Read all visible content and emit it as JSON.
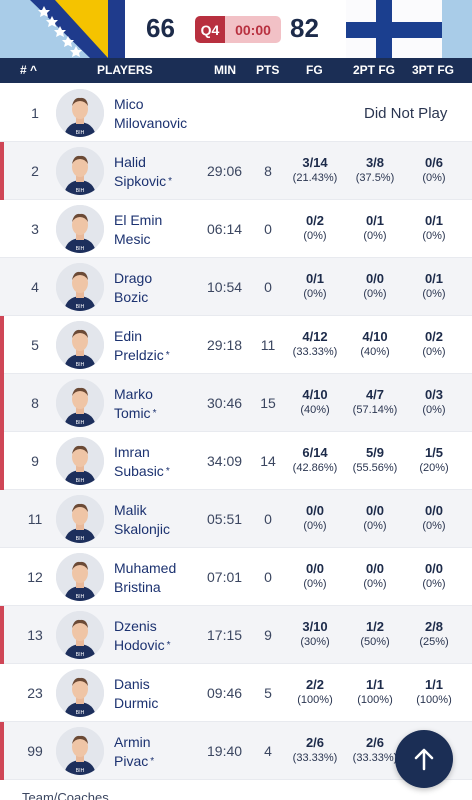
{
  "scoreboard": {
    "home_score": "66",
    "away_score": "82",
    "quarter": "Q4",
    "clock": "00:00",
    "home_flag": "bosnia-flag",
    "away_flag": "finland-flag"
  },
  "table_header": {
    "num": "#",
    "players": "PLAYERS",
    "min": "MIN",
    "pts": "PTS",
    "fg": "FG",
    "pt2": "2PT FG",
    "pt3": "3PT FG"
  },
  "players": [
    {
      "num": "1",
      "first": "Mico",
      "last": "Milovanovic",
      "starter": false,
      "dnp": "Did Not Play"
    },
    {
      "num": "2",
      "first": "Halid",
      "last": "Sipkovic",
      "starter": true,
      "min": "29:06",
      "pts": "8",
      "fg": "3/14",
      "fg_pct": "(21.43%)",
      "pt2": "3/8",
      "pt2_pct": "(37.5%)",
      "pt3": "0/6",
      "pt3_pct": "(0%)"
    },
    {
      "num": "3",
      "first": "El Emin",
      "last": "Mesic",
      "starter": false,
      "min": "06:14",
      "pts": "0",
      "fg": "0/2",
      "fg_pct": "(0%)",
      "pt2": "0/1",
      "pt2_pct": "(0%)",
      "pt3": "0/1",
      "pt3_pct": "(0%)"
    },
    {
      "num": "4",
      "first": "Drago",
      "last": "Bozic",
      "starter": false,
      "min": "10:54",
      "pts": "0",
      "fg": "0/1",
      "fg_pct": "(0%)",
      "pt2": "0/0",
      "pt2_pct": "(0%)",
      "pt3": "0/1",
      "pt3_pct": "(0%)"
    },
    {
      "num": "5",
      "first": "Edin",
      "last": "Preldzic",
      "starter": true,
      "min": "29:18",
      "pts": "11",
      "fg": "4/12",
      "fg_pct": "(33.33%)",
      "pt2": "4/10",
      "pt2_pct": "(40%)",
      "pt3": "0/2",
      "pt3_pct": "(0%)"
    },
    {
      "num": "8",
      "first": "Marko",
      "last": "Tomic",
      "starter": true,
      "min": "30:46",
      "pts": "15",
      "fg": "4/10",
      "fg_pct": "(40%)",
      "pt2": "4/7",
      "pt2_pct": "(57.14%)",
      "pt3": "0/3",
      "pt3_pct": "(0%)"
    },
    {
      "num": "9",
      "first": "Imran",
      "last": "Subasic",
      "starter": true,
      "min": "34:09",
      "pts": "14",
      "fg": "6/14",
      "fg_pct": "(42.86%)",
      "pt2": "5/9",
      "pt2_pct": "(55.56%)",
      "pt3": "1/5",
      "pt3_pct": "(20%)"
    },
    {
      "num": "11",
      "first": "Malik",
      "last": "Skalonjic",
      "starter": false,
      "min": "05:51",
      "pts": "0",
      "fg": "0/0",
      "fg_pct": "(0%)",
      "pt2": "0/0",
      "pt2_pct": "(0%)",
      "pt3": "0/0",
      "pt3_pct": "(0%)"
    },
    {
      "num": "12",
      "first": "Muhamed",
      "last": "Bristina",
      "starter": false,
      "min": "07:01",
      "pts": "0",
      "fg": "0/0",
      "fg_pct": "(0%)",
      "pt2": "0/0",
      "pt2_pct": "(0%)",
      "pt3": "0/0",
      "pt3_pct": "(0%)"
    },
    {
      "num": "13",
      "first": "Dzenis",
      "last": "Hodovic",
      "starter": true,
      "min": "17:15",
      "pts": "9",
      "fg": "3/10",
      "fg_pct": "(30%)",
      "pt2": "1/2",
      "pt2_pct": "(50%)",
      "pt3": "2/8",
      "pt3_pct": "(25%)"
    },
    {
      "num": "23",
      "first": "Danis",
      "last": "Durmic",
      "starter": false,
      "min": "09:46",
      "pts": "5",
      "fg": "2/2",
      "fg_pct": "(100%)",
      "pt2": "1/1",
      "pt2_pct": "(100%)",
      "pt3": "1/1",
      "pt3_pct": "(100%)"
    },
    {
      "num": "99",
      "first": "Armin",
      "last": "Pivac",
      "starter": true,
      "min": "19:40",
      "pts": "4",
      "fg": "2/6",
      "fg_pct": "(33.33%)",
      "pt2": "2/6",
      "pt2_pct": "(33.33%)",
      "pt3": "",
      "pt3_pct": ""
    }
  ],
  "footer": {
    "label": "Team/Coaches"
  },
  "fab": {
    "icon": "arrow-up-icon"
  },
  "colors": {
    "header_bg": "#1b2e55",
    "starter_bar": "#cf4656",
    "quarter_bg": "#b8303f"
  }
}
